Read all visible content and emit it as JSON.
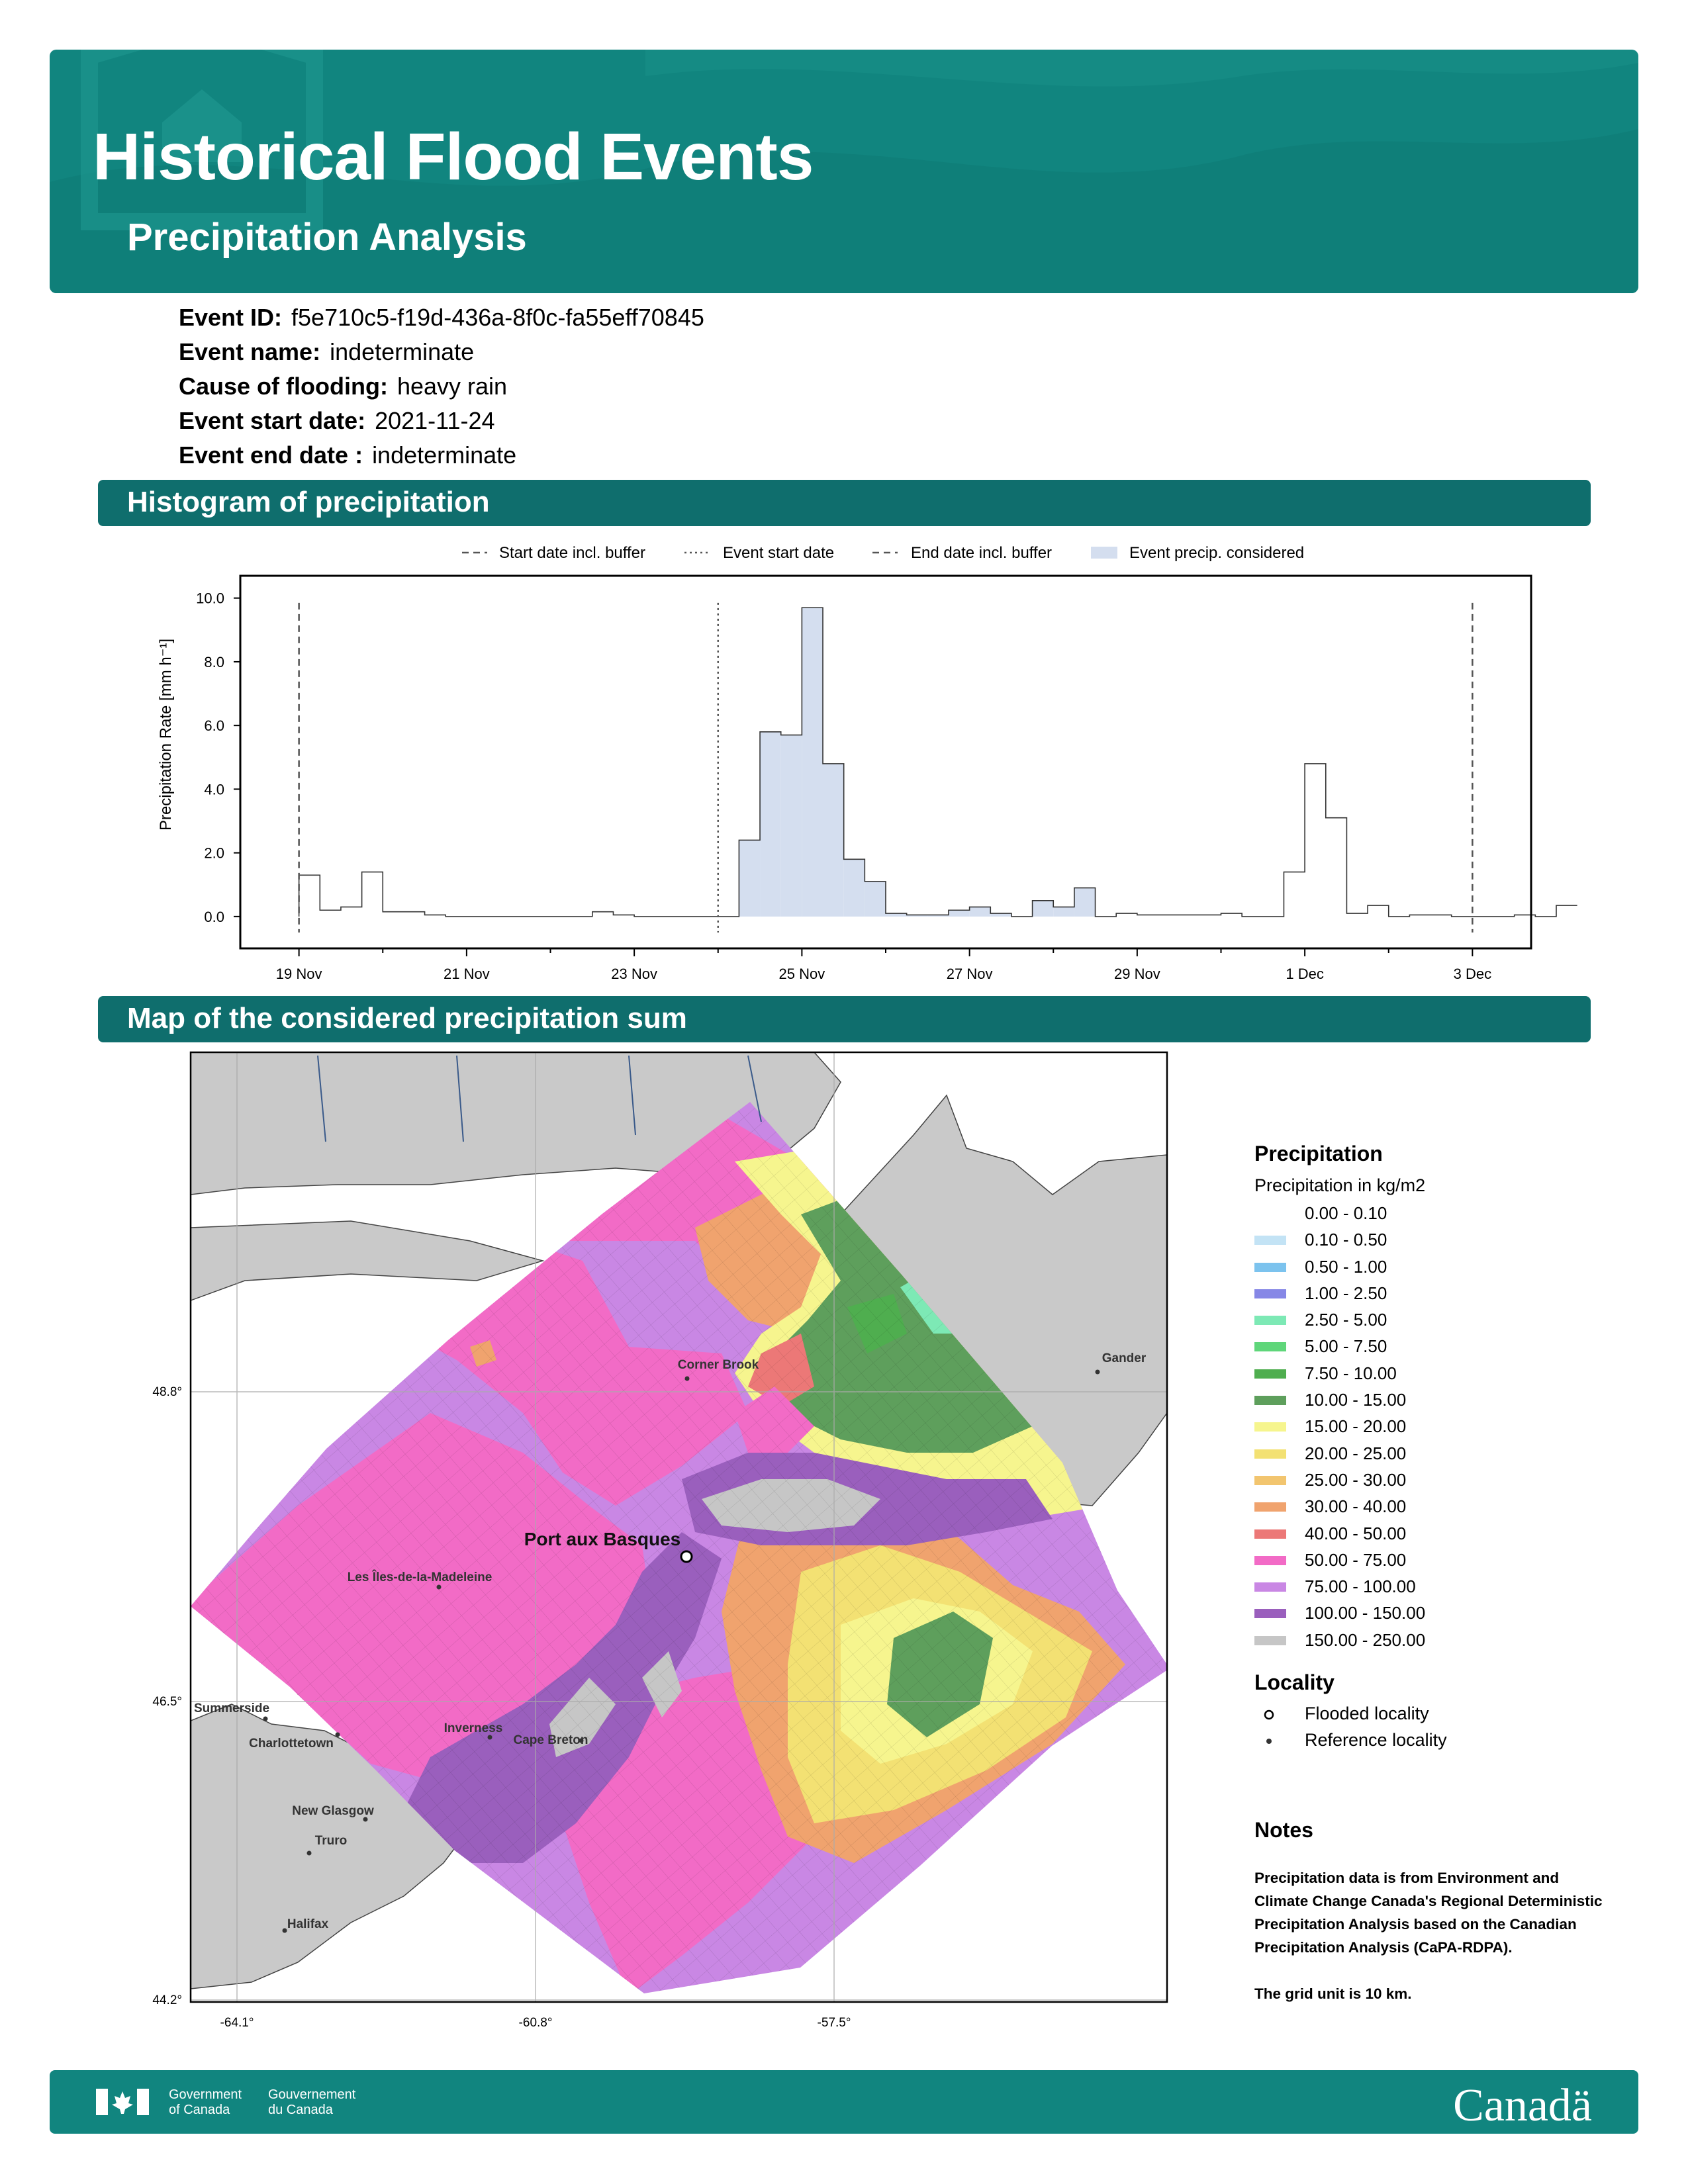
{
  "header": {
    "title": "Historical Flood Events",
    "subtitle": "Precipitation Analysis"
  },
  "event": [
    {
      "label": "Event ID:",
      "value": "f5e710c5-f19d-436a-8f0c-fa55eff70845"
    },
    {
      "label": "Event name:",
      "value": "indeterminate"
    },
    {
      "label": "Cause of flooding:",
      "value": "heavy rain"
    },
    {
      "label": "Event start date:",
      "value": "2021-11-24"
    },
    {
      "label": "Event end date :",
      "value": "indeterminate"
    }
  ],
  "sections": {
    "histogram": "Histogram of precipitation",
    "map": "Map of the considered precipitation sum"
  },
  "chart_data": {
    "type": "bar",
    "ylabel": "Precipitation Rate [mm h⁻¹]",
    "ylim": [
      -1.0,
      10.7
    ],
    "yticks": [
      "0.0",
      "2.0",
      "4.0",
      "6.0",
      "8.0",
      "10.0"
    ],
    "xticks": [
      "19 Nov",
      "21 Nov",
      "23 Nov",
      "25 Nov",
      "27 Nov",
      "29 Nov",
      "1 Dec",
      "3 Dec"
    ],
    "x_range_days": [
      18.3,
      33.7
    ],
    "bin_width_days": 0.25,
    "bin_start": "19 Nov 00:00",
    "values": [
      1.3,
      0.2,
      0.3,
      1.4,
      0.2,
      0.2,
      0.1,
      0.0,
      0.0,
      0.0,
      0.0,
      0.0,
      0.0,
      0.0,
      0.0,
      0.2,
      0.1,
      0.0,
      0.0,
      0.0,
      0.0,
      0.0,
      0.0,
      0.0,
      0.0,
      0.0,
      0.0,
      0.0,
      0.0,
      0.0,
      0.0,
      0.0,
      0.0,
      0.0,
      0.0,
      0.0,
      0.0,
      0.0,
      0.0,
      0.0,
      0.0,
      0.0,
      0.0,
      0.0,
      0.0,
      0.0,
      0.0,
      0.0,
      0.0,
      0.0,
      0.0,
      0.0,
      0.0,
      0.0,
      0.0,
      0.0,
      0.0
    ],
    "event_values": [
      2.4,
      5.8,
      5.7,
      9.7,
      4.8,
      1.8,
      1.1,
      0.1,
      0.05,
      0.0,
      0.2,
      0.3,
      0.1,
      0.0,
      0.5,
      0.3,
      0.9,
      0.0,
      0.1
    ],
    "hist": [
      1.3,
      0.2,
      0.3,
      1.4,
      0.15,
      0.15,
      0.05,
      0.0,
      0.0,
      0.0,
      0.0,
      0.0,
      0.0,
      0.0,
      0.15,
      0.05,
      0.0,
      0.0,
      0.0,
      0.0,
      0.0,
      2.4,
      5.8,
      5.7,
      9.7,
      4.8,
      1.8,
      1.1,
      0.1,
      0.05,
      0.05,
      0.2,
      0.3,
      0.1,
      0.0,
      0.5,
      0.3,
      0.9,
      0.0,
      0.1,
      0.05,
      0.05,
      0.05,
      0.05,
      0.1,
      0.0,
      0.0,
      1.4,
      4.8,
      3.1,
      0.1,
      0.35,
      0.0,
      0.05,
      0.05,
      0.0,
      0.0,
      0.0,
      0.05,
      0.0,
      0.35
    ],
    "event_bins": [
      21,
      39
    ],
    "start_buffer_day": 19.0,
    "event_start_day": 24.0,
    "end_buffer_day": 33.0,
    "legend": [
      "Start date incl. buffer",
      "Event start date",
      "End date incl. buffer",
      "Event precip. considered"
    ],
    "colors": {
      "fill": "#d4deef",
      "line": "#333333"
    }
  },
  "map": {
    "lat_labels": [
      "+48.8°",
      "+46.5°",
      "+44.2°"
    ],
    "lon_labels": [
      "-64.1°",
      "-60.8°",
      "-57.5°"
    ],
    "flooded_locality": "Port aux Basques",
    "reference_localities": [
      "Corner Brook",
      "Gander",
      "Les Îles-de-la-Madeleine",
      "Summerside",
      "Charlottetown",
      "Inverness",
      "Cape Breton",
      "New Glasgow",
      "Truro",
      "Halifax"
    ]
  },
  "legend": {
    "heading": "Precipitation",
    "subheading": "Precipitation in kg/m2",
    "classes": [
      {
        "label": "0.00 - 0.10",
        "color": "#ffffff"
      },
      {
        "label": "0.10 - 0.50",
        "color": "#c3e3f5"
      },
      {
        "label": "0.50 - 1.00",
        "color": "#7cc3ee"
      },
      {
        "label": "1.00 - 2.50",
        "color": "#8687e6"
      },
      {
        "label": "2.50 - 5.00",
        "color": "#7de9b5"
      },
      {
        "label": "5.00 - 7.50",
        "color": "#5fd67a"
      },
      {
        "label": "7.50 - 10.00",
        "color": "#4fae4f"
      },
      {
        "label": "10.00 - 15.00",
        "color": "#5e9f5c"
      },
      {
        "label": "15.00 - 20.00",
        "color": "#f6f58e"
      },
      {
        "label": "20.00 - 25.00",
        "color": "#f3e173"
      },
      {
        "label": "25.00 - 30.00",
        "color": "#f2c56f"
      },
      {
        "label": "30.00 - 40.00",
        "color": "#f0a36e"
      },
      {
        "label": "40.00 - 50.00",
        "color": "#ec7877"
      },
      {
        "label": "50.00 - 75.00",
        "color": "#f26bc6"
      },
      {
        "label": "75.00 - 100.00",
        "color": "#c987e4"
      },
      {
        "label": "100.00 - 150.00",
        "color": "#9a5fbd"
      },
      {
        "label": "150.00 - 250.00",
        "color": "#c6c6c6"
      }
    ],
    "locality_heading": "Locality",
    "locality_items": [
      "Flooded locality",
      "Reference locality"
    ]
  },
  "notes": {
    "heading": "Notes",
    "text1": "Precipitation data is from Environment and Climate Change Canada's Regional Deterministic Precipitation Analysis based on the Canadian Precipitation Analysis (CaPA-RDPA).",
    "text2": "The grid unit is 10 km."
  },
  "footer": {
    "gov_en": "Government of Canada",
    "gov_fr": "Gouvernement du Canada",
    "wordmark": "Canadä"
  }
}
